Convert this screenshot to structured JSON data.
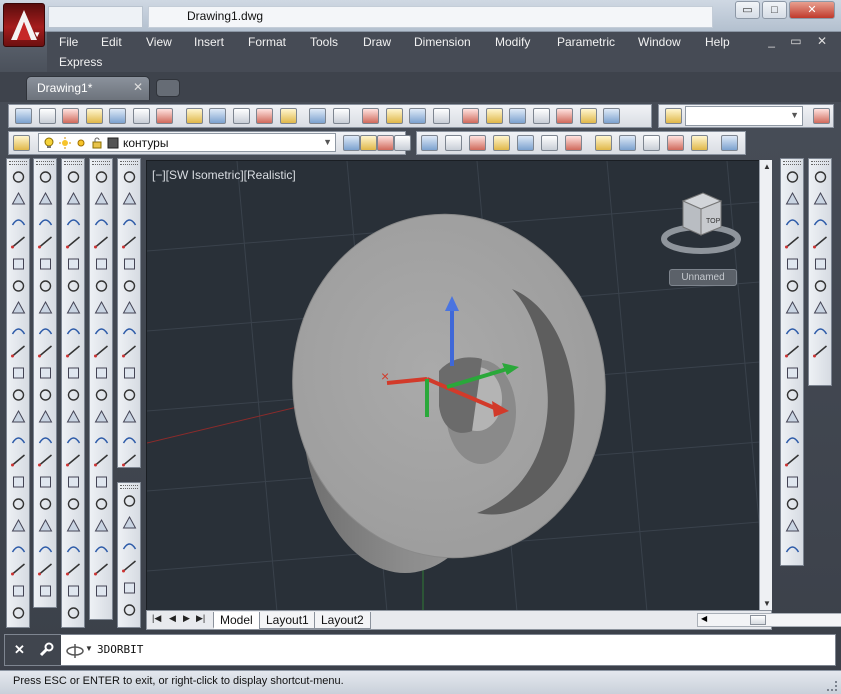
{
  "window": {
    "title": "Drawing1.dwg",
    "buttons": {
      "minimize": "▭",
      "maximize": "□",
      "close": "✕"
    }
  },
  "menu": [
    "File",
    "Edit",
    "View",
    "Insert",
    "Format",
    "Tools",
    "Draw",
    "Dimension",
    "Modify",
    "Parametric",
    "Window",
    "Help",
    "Express"
  ],
  "document_controls": "_ ▭ ✕",
  "tabs": {
    "active": "Drawing1*",
    "close": "✕"
  },
  "layer": {
    "name": "контуры"
  },
  "viewport": {
    "label": "[−][SW Isometric][Realistic]",
    "named_view": "Unnamed",
    "viewcube_face": "TOP"
  },
  "layout_tabs": [
    "Model",
    "Layout1",
    "Layout2"
  ],
  "command": {
    "text": "3DORBIT"
  },
  "status": {
    "text": "Press ESC or ENTER to exit, or right-click to display shortcut-menu."
  },
  "colors": {
    "accent": "#a51d1d",
    "viewport_bg": "#293038",
    "model_gray": "#9a9a9a",
    "ucs_x": "#d23a2a",
    "ucs_y": "#2aa83a",
    "ucs_z": "#3f68d8"
  },
  "icons": {
    "standard_toolbar": [
      "new-icon",
      "open-icon",
      "save-icon",
      "plot-icon",
      "plot-preview-icon",
      "publish-icon",
      "3d-print-icon",
      "cut-icon",
      "copy-icon",
      "copy-clip-icon",
      "paste-icon",
      "match-properties-icon",
      "undo-icon",
      "redo-icon",
      "pan-icon",
      "zoom-realtime-icon",
      "zoom-window-icon",
      "zoom-previous-icon",
      "properties-icon",
      "design-center-icon",
      "tool-palettes-icon",
      "sheet-set-icon",
      "markup-icon",
      "quickcalc-icon",
      "help-icon"
    ],
    "layer_toolbar": [
      "layer-properties-icon",
      "layer-state-icon",
      "layer-previous-icon",
      "layer-walk-icon"
    ],
    "ucs_toolbar": [
      "ucs-icon",
      "ucs-world-icon",
      "ucs-previous-icon",
      "ucs-face-icon",
      "ucs-object-icon",
      "ucs-view-icon",
      "ucs-origin-icon",
      "ucs-zaxis-icon",
      "ucs-3point-icon",
      "ucs-x-icon",
      "ucs-y-icon",
      "ucs-z-icon",
      "ucs-apply-icon"
    ]
  }
}
